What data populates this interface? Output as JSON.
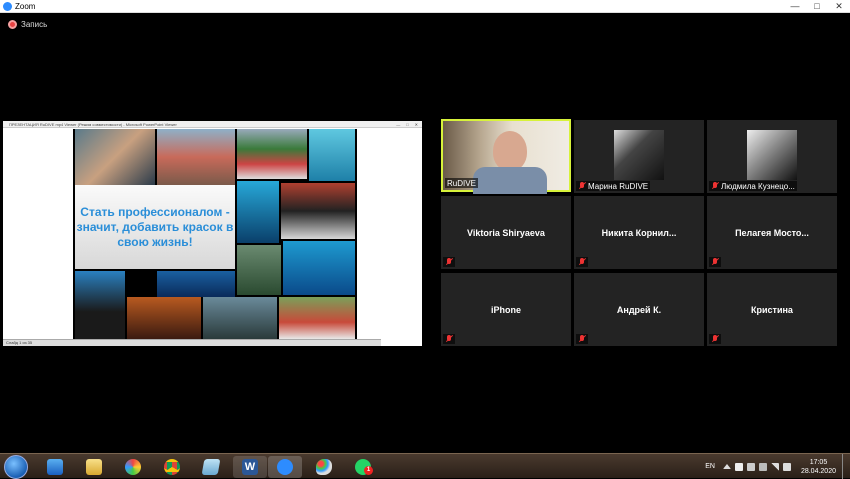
{
  "window": {
    "title": "Zoom",
    "minimize": "—",
    "maximize": "□",
    "close": "✕"
  },
  "recording": {
    "label": "Запись"
  },
  "share": {
    "window_title": "ПРЕЗЕНТАЦИЯ RuDIVE mp4 Viewer (Режим совместимости) - Microsoft PowerPoint Viewer",
    "status": "Слайд 1 из 35",
    "slide_text": "Стать профессионалом - значит, добавить красок в свою жизнь!"
  },
  "participants": [
    {
      "name": "RuDIVE",
      "video": true,
      "active": true,
      "muted": false
    },
    {
      "name": "Марина RuDIVE",
      "avatar": true,
      "muted": true
    },
    {
      "name": "Людмила Кузнецо...",
      "avatar": true,
      "muted": true
    },
    {
      "name": "Viktoria Shiryaeva",
      "muted": true
    },
    {
      "name": "Никита  Корнил...",
      "muted": true
    },
    {
      "name": "Пелагея  Мосто...",
      "muted": true
    },
    {
      "name": "iPhone",
      "muted": true
    },
    {
      "name": "Андрей К.",
      "muted": true
    },
    {
      "name": "Кристина",
      "muted": true
    }
  ],
  "taskbar": {
    "apps": [
      "windows-media-player",
      "file-explorer",
      "photos",
      "chrome",
      "notepad",
      "word",
      "zoom",
      "paint",
      "whatsapp"
    ],
    "word_label": "W",
    "whatsapp_badge": "1",
    "lang": "EN",
    "time": "17:05",
    "date": "28.04.2020"
  },
  "colors": {
    "active_border": "#d7f23a",
    "tile_bg": "#232323",
    "mute_red": "#e33333",
    "zoom_blue": "#2d8cff"
  }
}
